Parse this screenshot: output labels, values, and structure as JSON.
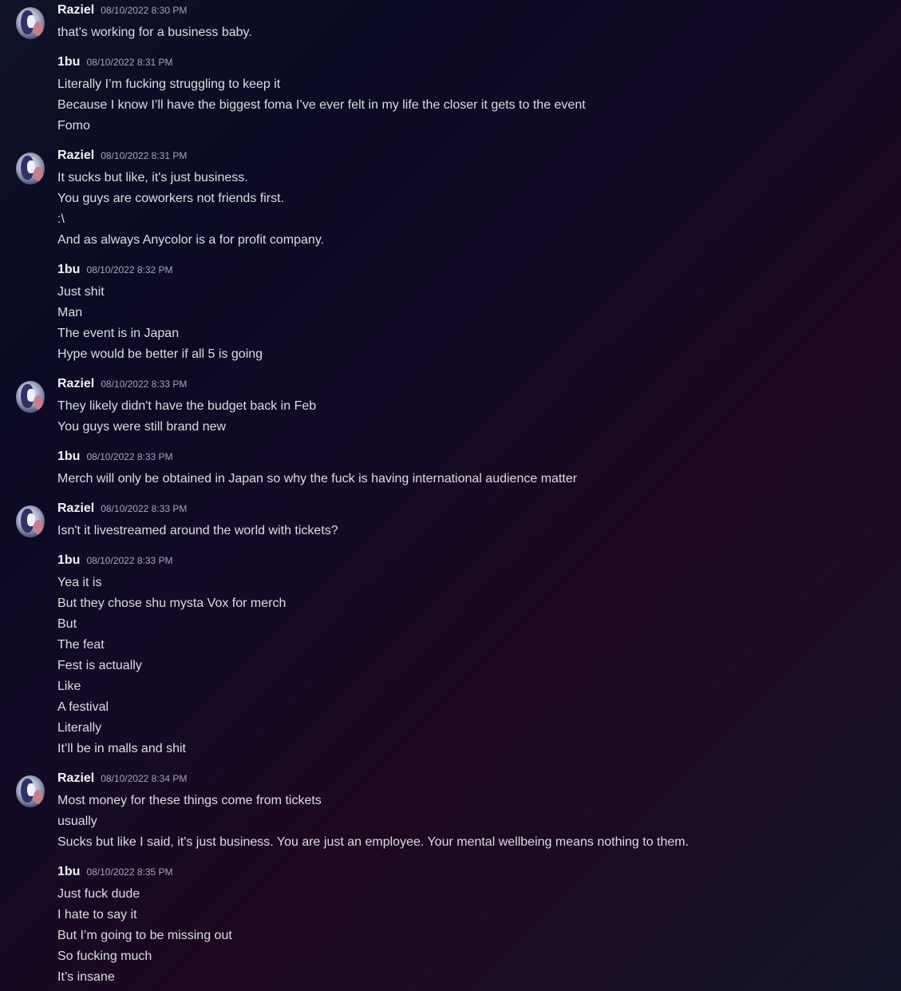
{
  "messages": [
    {
      "author": "Raziel",
      "timestamp": "08/10/2022 8:30 PM",
      "has_avatar": true,
      "lines": [
        "that's working for a business baby."
      ]
    },
    {
      "author": "1bu",
      "timestamp": "08/10/2022 8:31 PM",
      "has_avatar": false,
      "lines": [
        "Literally I’m fucking struggling to keep it",
        "Because I know I’ll have the biggest foma I’ve ever felt in my life the closer it gets to the event",
        "Fomo"
      ]
    },
    {
      "author": "Raziel",
      "timestamp": "08/10/2022 8:31 PM",
      "has_avatar": true,
      "lines": [
        "It sucks but like, it's just business.",
        "You guys are coworkers not friends first.",
        ":\\",
        "And as always Anycolor is a for profit company."
      ]
    },
    {
      "author": "1bu",
      "timestamp": "08/10/2022 8:32 PM",
      "has_avatar": false,
      "lines": [
        "Just shit",
        "Man",
        "The event is in Japan",
        "Hype would be better if all 5 is going"
      ]
    },
    {
      "author": "Raziel",
      "timestamp": "08/10/2022 8:33 PM",
      "has_avatar": true,
      "lines": [
        "They likely didn't have the budget back in Feb",
        "You guys were still brand new"
      ]
    },
    {
      "author": "1bu",
      "timestamp": "08/10/2022 8:33 PM",
      "has_avatar": false,
      "lines": [
        "Merch will only be obtained in Japan so why the fuck is having international audience matter"
      ]
    },
    {
      "author": "Raziel",
      "timestamp": "08/10/2022 8:33 PM",
      "has_avatar": true,
      "lines": [
        "Isn't it livestreamed around the world with tickets?"
      ]
    },
    {
      "author": "1bu",
      "timestamp": "08/10/2022 8:33 PM",
      "has_avatar": false,
      "lines": [
        "Yea it is",
        "But they chose shu mysta Vox for merch",
        "But",
        "The feat",
        "Fest is actually",
        "Like",
        "A festival",
        "Literally",
        "It’ll be in malls and shit"
      ]
    },
    {
      "author": "Raziel",
      "timestamp": "08/10/2022 8:34 PM",
      "has_avatar": true,
      "lines": [
        "Most money for these things come from tickets",
        "usually",
        "Sucks but like I said, it's just business. You are just an employee. Your mental wellbeing means nothing to them."
      ]
    },
    {
      "author": "1bu",
      "timestamp": "08/10/2022 8:35 PM",
      "has_avatar": false,
      "lines": [
        "Just fuck dude",
        "I hate to say it",
        "But I’m going to be missing out",
        "So fucking much",
        "It’s insane"
      ]
    }
  ]
}
